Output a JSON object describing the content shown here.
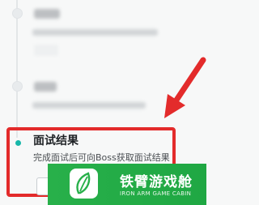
{
  "steps": [
    {
      "title": "",
      "desc": ""
    },
    {
      "title": "",
      "desc": ""
    }
  ],
  "highlighted_step": {
    "title": "面试结果",
    "description": "完成面试后可向Boss获取面试结果"
  },
  "colors": {
    "highlight_border": "#e32b2b",
    "active_dot": "#17b7a9",
    "watermark_bg": "#28b04a"
  },
  "watermark": {
    "name": "铁臂游戏舱",
    "subtitle": "IRON ARM GAME CABIN",
    "logo_icon": "leaf-logo-icon"
  }
}
